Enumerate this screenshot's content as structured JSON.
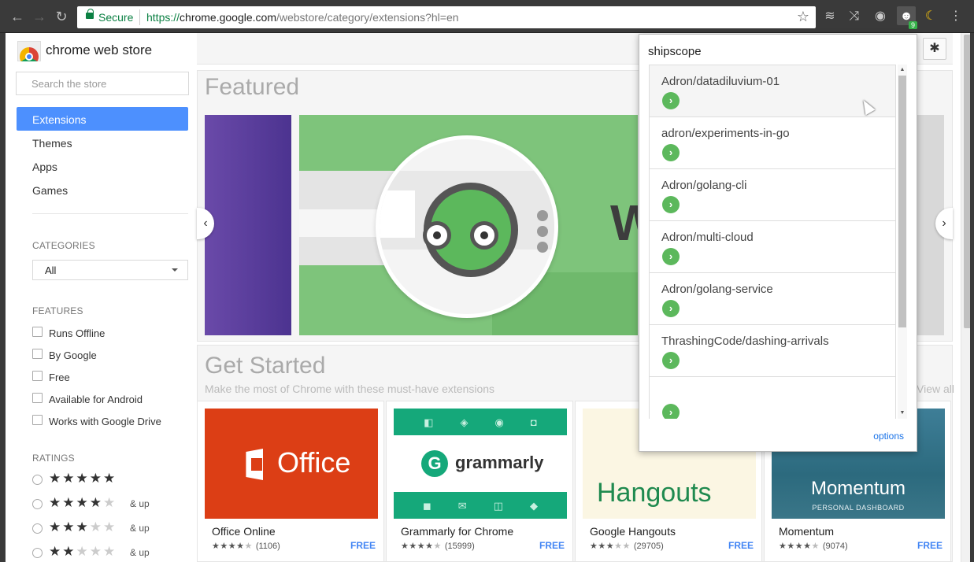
{
  "browser": {
    "secure_label": "Secure",
    "url_scheme": "https://",
    "url_host": "chrome.google.com",
    "url_path": "/webstore/category/extensions?hl=en",
    "extension_badge": "9"
  },
  "sidebar": {
    "store_title": "chrome web store",
    "search_placeholder": "Search the store",
    "nav": [
      {
        "label": "Extensions",
        "active": true
      },
      {
        "label": "Themes",
        "active": false
      },
      {
        "label": "Apps",
        "active": false
      },
      {
        "label": "Games",
        "active": false
      }
    ],
    "categories_label": "CATEGORIES",
    "category_selected": "All",
    "features_label": "FEATURES",
    "features": [
      "Runs Offline",
      "By Google",
      "Free",
      "Available for Android",
      "Works with Google Drive"
    ],
    "ratings_label": "RATINGS",
    "ratings": [
      {
        "stars": 5,
        "suffix": ""
      },
      {
        "stars": 4,
        "suffix": "& up"
      },
      {
        "stars": 3,
        "suffix": "& up"
      },
      {
        "stars": 2,
        "suffix": "& up"
      }
    ]
  },
  "main": {
    "featured_title": "Featured",
    "get_started_title": "Get Started",
    "get_started_subtitle": "Make the most of Chrome with these must-have extensions",
    "view_all": "View all",
    "tiles": [
      {
        "name": "Office Online",
        "rating": 4,
        "count": "(1106)",
        "price": "FREE",
        "art_text": "Office"
      },
      {
        "name": "Grammarly for Chrome",
        "rating": 4.5,
        "count": "(15999)",
        "price": "FREE",
        "art_text": "grammarly"
      },
      {
        "name": "Google Hangouts",
        "rating": 3.5,
        "count": "(29705)",
        "price": "FREE",
        "art_text": "Hangouts"
      },
      {
        "name": "Momentum",
        "rating": 4.5,
        "count": "(9074)",
        "price": "FREE",
        "art_text": "Momentum",
        "art_subtext": "PERSONAL DASHBOARD"
      }
    ]
  },
  "popup": {
    "title": "shipscope",
    "repos": [
      "Adron/datadiluvium-01",
      "adron/experiments-in-go",
      "Adron/golang-cli",
      "Adron/multi-cloud",
      "Adron/golang-service",
      "ThrashingCode/dashing-arrivals",
      ""
    ],
    "options_label": "options"
  }
}
